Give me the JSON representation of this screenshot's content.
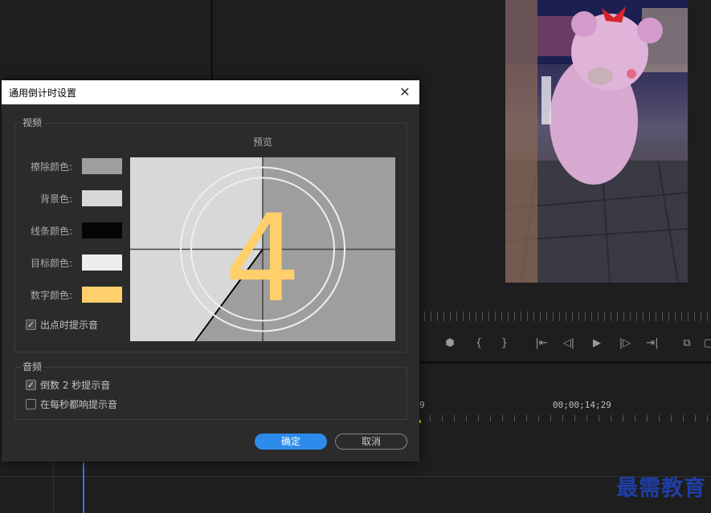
{
  "dialog": {
    "title": "通用倒计时设置",
    "video_group": "视频",
    "preview_label": "预览",
    "colors": [
      {
        "label": "擦除颜色:",
        "color": "#9e9e9e"
      },
      {
        "label": "背景色:",
        "color": "#d8d8d8"
      },
      {
        "label": "线条颜色:",
        "color": "#050505"
      },
      {
        "label": "目标颜色:",
        "color": "#eeeeee"
      },
      {
        "label": "数字颜色:",
        "color": "#ffcf6b"
      }
    ],
    "cue_tone_label": "出点时提示音",
    "cue_tone_checked": true,
    "audio_group": "音频",
    "beep_2s_label": "倒数 2 秒提示音",
    "beep_2s_checked": true,
    "beep_each_label": "在每秒都响提示音",
    "beep_each_checked": false,
    "ok_label": "确定",
    "cancel_label": "取消",
    "preview_digit": "4",
    "check_mark": "✓"
  },
  "background": {
    "timecode_a": "9",
    "timecode_b": "00;00;14;29",
    "watermark": "最需教育",
    "controls": [
      "⬢",
      "{",
      "}",
      "|⇤",
      "◁|",
      "▶",
      "|▷",
      "⇥|",
      "⧉",
      "▢"
    ]
  }
}
